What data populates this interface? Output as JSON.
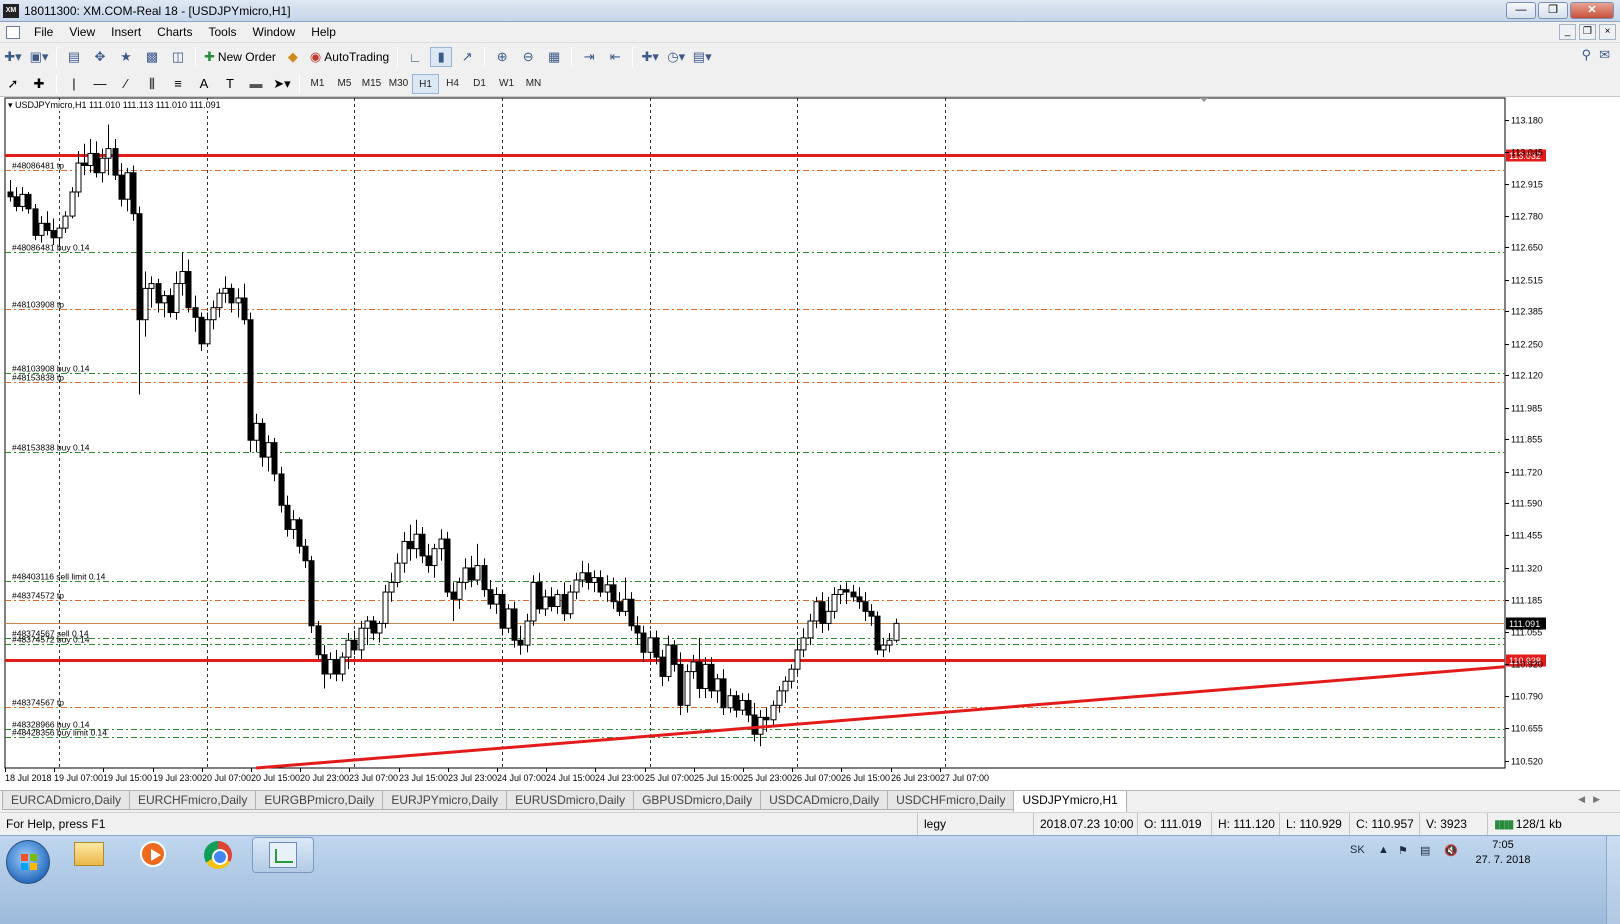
{
  "window": {
    "title": "18011300: XM.COM-Real 18 - [USDJPYmicro,H1]",
    "app_icon_text": "XM"
  },
  "menu": [
    "File",
    "View",
    "Insert",
    "Charts",
    "Tools",
    "Window",
    "Help"
  ],
  "toolbar": {
    "new_order_label": "New Order",
    "autotrading_label": "AutoTrading",
    "timeframes": [
      "M1",
      "M5",
      "M15",
      "M30",
      "H1",
      "H4",
      "D1",
      "W1",
      "MN"
    ],
    "active_timeframe": "H1"
  },
  "chart": {
    "symbol_header": "USDJPYmicro,H1  111.010 111.113 111.010 111.091",
    "colors": {
      "red_line": "#e31b1b",
      "tp_line": "#e06a2c",
      "order_line": "#2f8a2f",
      "bid_line": "#c8884a",
      "candle": "#000000"
    }
  },
  "chart_data": {
    "type": "candlestick",
    "symbol": "USDJPYmicro",
    "timeframe": "H1",
    "ohlc_header": {
      "open": 111.01,
      "high": 111.113,
      "low": 111.01,
      "close": 111.091
    },
    "ylim": [
      110.49,
      113.27
    ],
    "y_ticks": [
      "113.180",
      "113.045",
      "112.915",
      "112.780",
      "112.650",
      "112.515",
      "112.385",
      "112.250",
      "112.120",
      "111.985",
      "111.855",
      "111.720",
      "111.590",
      "111.455",
      "111.320",
      "111.185",
      "111.055",
      "110.920",
      "110.790",
      "110.655",
      "110.520"
    ],
    "x_ticks": [
      "18 Jul 2018",
      "19 Jul 07:00",
      "19 Jul 15:00",
      "19 Jul 23:00",
      "20 Jul 07:00",
      "20 Jul 15:00",
      "20 Jul 23:00",
      "23 Jul 07:00",
      "23 Jul 15:00",
      "23 Jul 23:00",
      "24 Jul 07:00",
      "24 Jul 15:00",
      "24 Jul 23:00",
      "25 Jul 07:00",
      "25 Jul 15:00",
      "25 Jul 23:00",
      "26 Jul 07:00",
      "26 Jul 15:00",
      "26 Jul 23:00",
      "27 Jul 07:00"
    ],
    "horizontal_lines": [
      {
        "price": 113.032,
        "label": "",
        "price_tag": "113.032",
        "style": "solid-red"
      },
      {
        "price": 112.97,
        "label": "#48086481 tp",
        "style": "tp"
      },
      {
        "price": 112.63,
        "label": "#48086481 buy 0.14",
        "style": "order"
      },
      {
        "price": 112.395,
        "label": "#48103908 tp",
        "style": "tp"
      },
      {
        "price": 112.13,
        "label": "#48103908 buy 0.14",
        "style": "order"
      },
      {
        "price": 112.09,
        "label": "#48153838 tp",
        "style": "tp"
      },
      {
        "price": 111.8,
        "label": "#48153838 buy 0.14",
        "style": "order"
      },
      {
        "price": 111.265,
        "label": "#48403116 sell limit 0.14",
        "style": "order"
      },
      {
        "price": 111.185,
        "label": "#48374572 tp",
        "style": "tp"
      },
      {
        "price": 111.091,
        "label": "",
        "price_tag": "111.091",
        "style": "bid"
      },
      {
        "price": 111.03,
        "label": "#48374567 sell 0.14",
        "style": "order"
      },
      {
        "price": 111.005,
        "label": "#48374572 buy 0.14",
        "style": "order"
      },
      {
        "price": 110.938,
        "label": "",
        "price_tag": "110.938",
        "style": "solid-red"
      },
      {
        "price": 110.745,
        "label": "#48374567 tp",
        "style": "tp"
      },
      {
        "price": 110.65,
        "label": "#48328966 buy 0.14",
        "style": "order"
      },
      {
        "price": 110.62,
        "label": "#48428356 buy limit 0.14",
        "style": "order"
      }
    ],
    "trendline": {
      "from": {
        "x": "20 Jul 15:00",
        "y": 110.49
      },
      "to": {
        "x": "27 Jul 10:00",
        "y": 110.91
      }
    },
    "candles": [
      [
        112.88,
        112.93,
        112.84,
        112.86
      ],
      [
        112.86,
        112.9,
        112.8,
        112.82
      ],
      [
        112.82,
        112.9,
        112.8,
        112.87
      ],
      [
        112.87,
        112.88,
        112.79,
        112.81
      ],
      [
        112.81,
        112.83,
        112.68,
        112.7
      ],
      [
        112.7,
        112.78,
        112.67,
        112.75
      ],
      [
        112.75,
        112.8,
        112.7,
        112.72
      ],
      [
        112.72,
        112.77,
        112.66,
        112.69
      ],
      [
        112.69,
        112.74,
        112.65,
        112.73
      ],
      [
        112.73,
        112.8,
        112.71,
        112.78
      ],
      [
        112.78,
        112.9,
        112.77,
        112.88
      ],
      [
        112.88,
        113.05,
        112.86,
        113.0
      ],
      [
        113.0,
        113.08,
        112.95,
        112.99
      ],
      [
        112.99,
        113.1,
        112.96,
        113.04
      ],
      [
        113.04,
        113.09,
        112.94,
        112.96
      ],
      [
        112.96,
        113.06,
        112.92,
        113.02
      ],
      [
        113.02,
        113.16,
        112.95,
        113.06
      ],
      [
        113.06,
        113.1,
        112.93,
        112.95
      ],
      [
        112.95,
        113.0,
        112.82,
        112.85
      ],
      [
        112.85,
        112.98,
        112.8,
        112.96
      ],
      [
        112.96,
        112.99,
        112.76,
        112.79
      ],
      [
        112.79,
        112.82,
        112.04,
        112.35
      ],
      [
        112.35,
        112.55,
        112.28,
        112.48
      ],
      [
        112.48,
        112.53,
        112.4,
        112.5
      ],
      [
        112.5,
        112.52,
        112.38,
        112.42
      ],
      [
        112.42,
        112.47,
        112.36,
        112.45
      ],
      [
        112.45,
        112.48,
        112.36,
        112.38
      ],
      [
        112.38,
        112.55,
        112.35,
        112.5
      ],
      [
        112.5,
        112.63,
        112.45,
        112.55
      ],
      [
        112.55,
        112.6,
        112.38,
        112.4
      ],
      [
        112.4,
        112.45,
        112.3,
        112.36
      ],
      [
        112.36,
        112.38,
        112.22,
        112.25
      ],
      [
        112.25,
        112.38,
        112.24,
        112.35
      ],
      [
        112.35,
        112.43,
        112.31,
        112.4
      ],
      [
        112.4,
        112.48,
        112.36,
        112.46
      ],
      [
        112.46,
        112.53,
        112.42,
        112.48
      ],
      [
        112.48,
        112.5,
        112.38,
        112.42
      ],
      [
        112.42,
        112.48,
        112.36,
        112.44
      ],
      [
        112.44,
        112.5,
        112.33,
        112.35
      ],
      [
        112.35,
        112.38,
        111.8,
        111.85
      ],
      [
        111.85,
        111.96,
        111.8,
        111.92
      ],
      [
        111.92,
        111.94,
        111.74,
        111.78
      ],
      [
        111.78,
        111.87,
        111.72,
        111.84
      ],
      [
        111.84,
        111.86,
        111.68,
        111.71
      ],
      [
        111.71,
        111.74,
        111.55,
        111.58
      ],
      [
        111.58,
        111.62,
        111.45,
        111.48
      ],
      [
        111.48,
        111.56,
        111.44,
        111.52
      ],
      [
        111.52,
        111.53,
        111.38,
        111.41
      ],
      [
        111.41,
        111.44,
        111.32,
        111.35
      ],
      [
        111.35,
        111.37,
        111.05,
        111.08
      ],
      [
        111.08,
        111.1,
        110.94,
        110.96
      ],
      [
        110.96,
        111.0,
        110.82,
        110.88
      ],
      [
        110.88,
        110.97,
        110.86,
        110.94
      ],
      [
        110.94,
        110.98,
        110.85,
        110.88
      ],
      [
        110.88,
        110.97,
        110.85,
        110.95
      ],
      [
        110.95,
        111.05,
        110.9,
        111.02
      ],
      [
        111.02,
        111.06,
        110.96,
        110.98
      ],
      [
        110.98,
        111.1,
        110.94,
        111.07
      ],
      [
        111.07,
        111.12,
        111.0,
        111.1
      ],
      [
        111.1,
        111.12,
        111.02,
        111.05
      ],
      [
        111.05,
        111.1,
        111.01,
        111.09
      ],
      [
        111.09,
        111.25,
        111.07,
        111.22
      ],
      [
        111.22,
        111.3,
        111.18,
        111.26
      ],
      [
        111.26,
        111.38,
        111.24,
        111.34
      ],
      [
        111.34,
        111.47,
        111.3,
        111.43
      ],
      [
        111.43,
        111.5,
        111.35,
        111.4
      ],
      [
        111.4,
        111.52,
        111.36,
        111.46
      ],
      [
        111.46,
        111.49,
        111.34,
        111.37
      ],
      [
        111.37,
        111.42,
        111.3,
        111.33
      ],
      [
        111.33,
        111.42,
        111.28,
        111.4
      ],
      [
        111.4,
        111.48,
        111.35,
        111.44
      ],
      [
        111.44,
        111.47,
        111.2,
        111.22
      ],
      [
        111.22,
        111.26,
        111.1,
        111.19
      ],
      [
        111.19,
        111.28,
        111.15,
        111.26
      ],
      [
        111.26,
        111.36,
        111.23,
        111.32
      ],
      [
        111.32,
        111.37,
        111.24,
        111.27
      ],
      [
        111.27,
        111.42,
        111.25,
        111.33
      ],
      [
        111.33,
        111.36,
        111.2,
        111.23
      ],
      [
        111.23,
        111.27,
        111.15,
        111.17
      ],
      [
        111.17,
        111.24,
        111.13,
        111.21
      ],
      [
        111.21,
        111.23,
        111.04,
        111.07
      ],
      [
        111.07,
        111.17,
        111.05,
        111.15
      ],
      [
        111.15,
        111.18,
        110.99,
        111.02
      ],
      [
        111.02,
        111.08,
        110.96,
        111.0
      ],
      [
        111.0,
        111.13,
        110.97,
        111.1
      ],
      [
        111.1,
        111.29,
        111.08,
        111.26
      ],
      [
        111.26,
        111.3,
        111.13,
        111.15
      ],
      [
        111.15,
        111.23,
        111.12,
        111.2
      ],
      [
        111.2,
        111.24,
        111.14,
        111.16
      ],
      [
        111.16,
        111.23,
        111.13,
        111.21
      ],
      [
        111.21,
        111.26,
        111.1,
        111.13
      ],
      [
        111.13,
        111.25,
        111.11,
        111.22
      ],
      [
        111.22,
        111.3,
        111.19,
        111.27
      ],
      [
        111.27,
        111.35,
        111.24,
        111.3
      ],
      [
        111.3,
        111.34,
        111.23,
        111.26
      ],
      [
        111.26,
        111.31,
        111.22,
        111.28
      ],
      [
        111.28,
        111.31,
        111.2,
        111.22
      ],
      [
        111.22,
        111.29,
        111.18,
        111.25
      ],
      [
        111.25,
        111.28,
        111.15,
        111.18
      ],
      [
        111.18,
        111.22,
        111.12,
        111.14
      ],
      [
        111.14,
        111.28,
        111.12,
        111.19
      ],
      [
        111.19,
        111.22,
        111.06,
        111.08
      ],
      [
        111.08,
        111.12,
        111.0,
        111.05
      ],
      [
        111.05,
        111.08,
        110.93,
        110.97
      ],
      [
        110.97,
        111.06,
        110.94,
        111.03
      ],
      [
        111.03,
        111.06,
        110.92,
        110.95
      ],
      [
        110.95,
        110.98,
        110.83,
        110.87
      ],
      [
        110.87,
        111.04,
        110.85,
        111.0
      ],
      [
        111.0,
        111.02,
        110.89,
        110.92
      ],
      [
        110.92,
        110.97,
        110.71,
        110.75
      ],
      [
        110.75,
        110.92,
        110.72,
        110.89
      ],
      [
        110.89,
        110.96,
        110.86,
        110.93
      ],
      [
        110.93,
        111.03,
        110.78,
        110.82
      ],
      [
        110.82,
        110.95,
        110.78,
        110.92
      ],
      [
        110.92,
        110.95,
        110.78,
        110.81
      ],
      [
        110.81,
        110.88,
        110.76,
        110.86
      ],
      [
        110.86,
        110.9,
        110.71,
        110.74
      ],
      [
        110.74,
        110.82,
        110.72,
        110.79
      ],
      [
        110.79,
        110.81,
        110.7,
        110.73
      ],
      [
        110.73,
        110.8,
        110.71,
        110.77
      ],
      [
        110.77,
        110.8,
        110.68,
        110.71
      ],
      [
        110.71,
        110.76,
        110.6,
        110.63
      ],
      [
        110.63,
        110.73,
        110.58,
        110.7
      ],
      [
        110.7,
        110.74,
        110.64,
        110.69
      ],
      [
        110.69,
        110.77,
        110.66,
        110.75
      ],
      [
        110.75,
        110.83,
        110.72,
        110.81
      ],
      [
        110.81,
        110.87,
        110.76,
        110.85
      ],
      [
        110.85,
        110.92,
        110.82,
        110.9
      ],
      [
        110.9,
        111.02,
        110.88,
        110.98
      ],
      [
        110.98,
        111.07,
        110.95,
        111.03
      ],
      [
        111.03,
        111.13,
        111.0,
        111.1
      ],
      [
        111.1,
        111.2,
        111.07,
        111.18
      ],
      [
        111.18,
        111.22,
        111.05,
        111.09
      ],
      [
        111.09,
        111.2,
        111.06,
        111.14
      ],
      [
        111.14,
        111.24,
        111.11,
        111.21
      ],
      [
        111.21,
        111.25,
        111.17,
        111.23
      ],
      [
        111.23,
        111.26,
        111.17,
        111.22
      ],
      [
        111.22,
        111.25,
        111.18,
        111.2
      ],
      [
        111.2,
        111.24,
        111.15,
        111.18
      ],
      [
        111.18,
        111.22,
        111.1,
        111.14
      ],
      [
        111.14,
        111.17,
        111.08,
        111.12
      ],
      [
        111.12,
        111.14,
        110.96,
        110.98
      ],
      [
        110.98,
        111.03,
        110.95,
        111.0
      ],
      [
        111.0,
        111.05,
        110.97,
        111.02
      ],
      [
        111.02,
        111.11,
        111.01,
        111.09
      ]
    ]
  },
  "tabs": [
    "EURCADmicro,Daily",
    "EURCHFmicro,Daily",
    "EURGBPmicro,Daily",
    "EURJPYmicro,Daily",
    "EURUSDmicro,Daily",
    "GBPUSDmicro,Daily",
    "USDCADmicro,Daily",
    "USDCHFmicro,Daily",
    "USDJPYmicro,H1"
  ],
  "active_tab": "USDJPYmicro,H1",
  "status": {
    "help": "For Help, press F1",
    "profile": "legy",
    "datetime": "2018.07.23 10:00",
    "open": "O: 111.019",
    "high": "H: 111.120",
    "low": "L: 110.929",
    "close": "C: 110.957",
    "volume": "V: 3923",
    "traffic": "128/1 kb"
  },
  "taskbar": {
    "lang": "SK",
    "time": "7:05",
    "date": "27. 7. 2018"
  }
}
